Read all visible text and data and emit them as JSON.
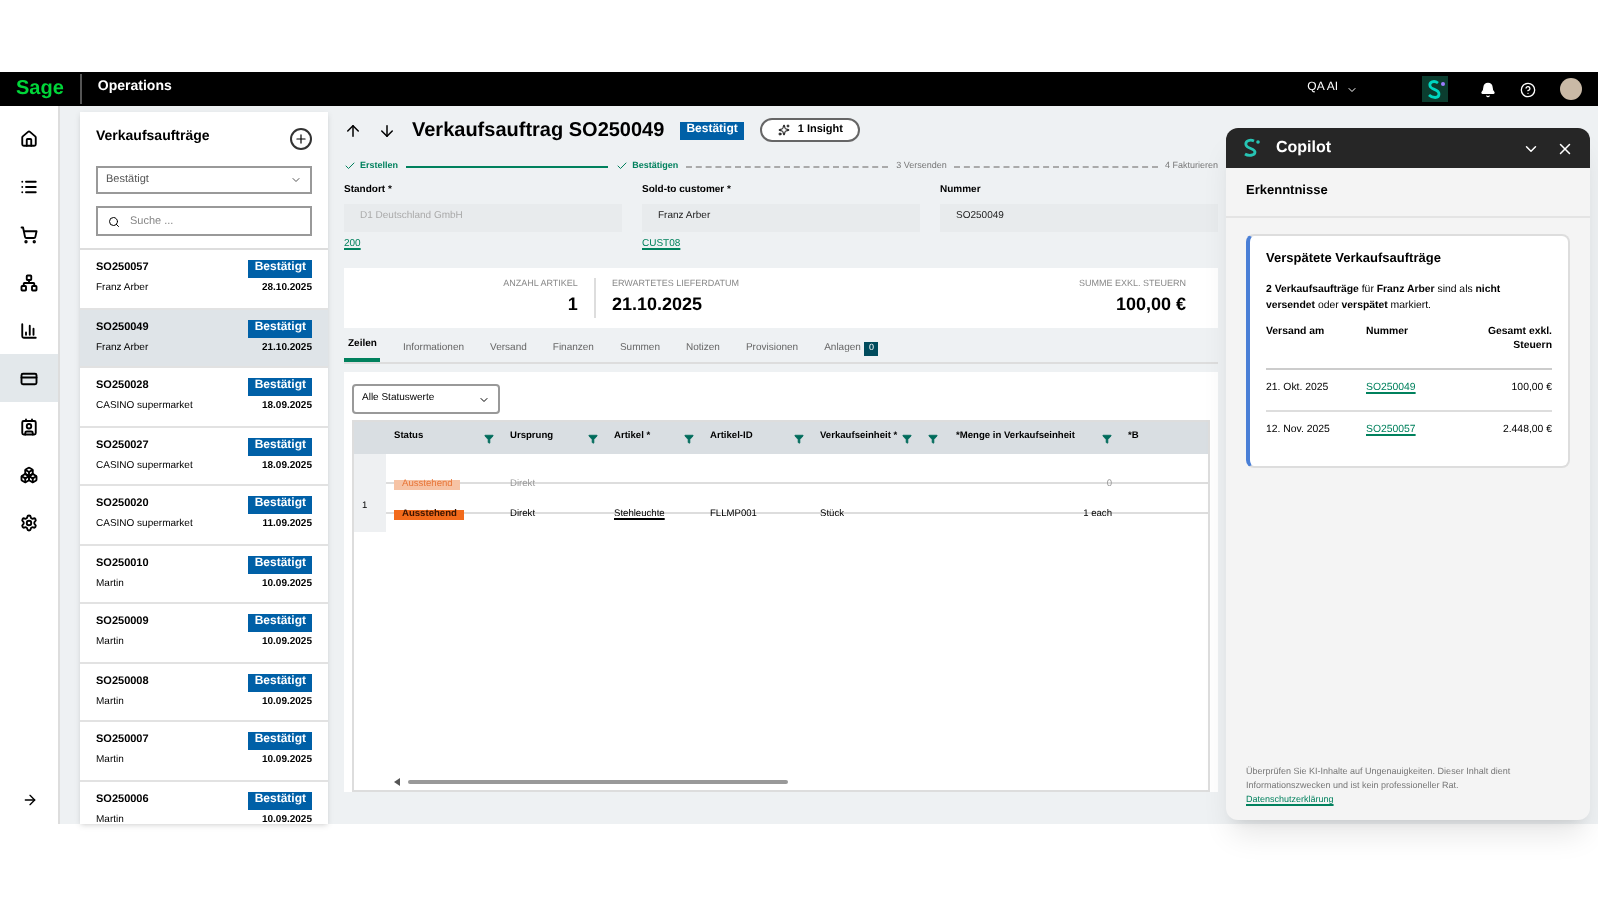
{
  "topbar": {
    "logo": "Sage",
    "app": "Operations",
    "company": "QA AI"
  },
  "rail": [
    {
      "selected": false
    },
    {
      "selected": false
    },
    {
      "selected": false
    },
    {
      "selected": false
    },
    {
      "selected": false
    },
    {
      "selected": true
    },
    {
      "selected": false
    },
    {
      "selected": false
    },
    {
      "selected": false
    }
  ],
  "sidebar": {
    "title": "Verkaufsaufträge",
    "filter": "Bestätigt",
    "search": {
      "placeholder": "Suche ..."
    },
    "items": [
      {
        "number": "SO250057",
        "customer": "Franz Arber",
        "status": "Bestätigt",
        "date": "28.10.2025",
        "selected": false
      },
      {
        "number": "SO250049",
        "customer": "Franz Arber",
        "status": "Bestätigt",
        "date": "21.10.2025",
        "selected": true
      },
      {
        "number": "SO250028",
        "customer": "CASINO supermarket",
        "status": "Bestätigt",
        "date": "18.09.2025",
        "selected": false
      },
      {
        "number": "SO250027",
        "customer": "CASINO supermarket",
        "status": "Bestätigt",
        "date": "18.09.2025",
        "selected": false
      },
      {
        "number": "SO250020",
        "customer": "CASINO supermarket",
        "status": "Bestätigt",
        "date": "11.09.2025",
        "selected": false
      },
      {
        "number": "SO250010",
        "customer": "Martin",
        "status": "Bestätigt",
        "date": "10.09.2025",
        "selected": false
      },
      {
        "number": "SO250009",
        "customer": "Martin",
        "status": "Bestätigt",
        "date": "10.09.2025",
        "selected": false
      },
      {
        "number": "SO250008",
        "customer": "Martin",
        "status": "Bestätigt",
        "date": "10.09.2025",
        "selected": false
      },
      {
        "number": "SO250007",
        "customer": "Martin",
        "status": "Bestätigt",
        "date": "10.09.2025",
        "selected": false
      },
      {
        "number": "SO250006",
        "customer": "Martin",
        "status": "Bestätigt",
        "date": "10.09.2025",
        "selected": false
      }
    ]
  },
  "header": {
    "title": "Verkaufsauftrag SO250049",
    "status": "Bestätigt",
    "insight": "1 Insight"
  },
  "steps": [
    {
      "label": "Erstellen",
      "done": true
    },
    {
      "label": "Bestätigen",
      "done": true
    },
    {
      "label": "3  Versenden",
      "done": false
    },
    {
      "label": "4  Fakturieren",
      "done": false
    }
  ],
  "fields": [
    {
      "label": "Standort *",
      "value": "D1 Deutschland GmbH",
      "disabled": true,
      "link": "200"
    },
    {
      "label": "Sold-to customer *",
      "value": "Franz Arber",
      "disabled": false,
      "link": "CUST08"
    },
    {
      "label": "Nummer",
      "value": "SO250049",
      "disabled": false
    }
  ],
  "summary": [
    {
      "label": "ANZAHL ARTIKEL",
      "value": "1"
    },
    {
      "label": "ERWARTETES LIEFERDATUM",
      "value": "21.10.2025"
    },
    {
      "label": "SUMME EXKL. STEUERN",
      "value": "100,00 €"
    }
  ],
  "tabs": [
    {
      "label": "Zeilen",
      "selected": true
    },
    {
      "label": "Informationen",
      "selected": false
    },
    {
      "label": "Versand",
      "selected": false
    },
    {
      "label": "Finanzen",
      "selected": false
    },
    {
      "label": "Summen",
      "selected": false
    },
    {
      "label": "Notizen",
      "selected": false
    },
    {
      "label": "Provisionen",
      "selected": false
    },
    {
      "label": "Anlagen",
      "selected": false,
      "count": "0"
    }
  ],
  "table": {
    "filter": "Alle Statuswerte",
    "columns": [
      "",
      "Status",
      "Ursprung",
      "Artikel *",
      "Artikel-ID",
      "Verkaufseinheit *",
      "",
      "*Menge in Verkaufseinheit",
      "*B"
    ],
    "rows": [
      {
        "kind": "phantom",
        "cells": [
          "",
          "Ausstehend",
          "Direkt",
          "",
          "",
          "",
          "",
          "0",
          ""
        ]
      },
      {
        "kind": "line",
        "cells": [
          "1",
          "Ausstehend",
          "Direkt",
          "Stehleuchte",
          "FLLMP001",
          "Stück",
          "",
          "1 each",
          ""
        ]
      }
    ]
  },
  "copilot": {
    "title": "Copilot",
    "section": "Erkenntnisse",
    "card_title": "Verspätete Verkaufsaufträge",
    "text": "**2 Verkaufsaufträge** für **Franz Arber** sind als **nicht versendet** oder **verspätet** markiert.",
    "columns": [
      "Versand am",
      "Nummer",
      "Gesamt exkl. Steuern"
    ],
    "rows": [
      [
        "21. Okt. 2025",
        "SO250049",
        "100,00 €"
      ],
      [
        "12. Nov. 2025",
        "SO250057",
        "2.448,00 €"
      ]
    ],
    "disclaimer": "Überprüfen Sie KI-Inhalte auf Ungenauigkeiten. Dieser Inhalt dient Informationszwecken und ist kein professioneller Rat.",
    "privacy": "Datenschutzerklärung"
  }
}
